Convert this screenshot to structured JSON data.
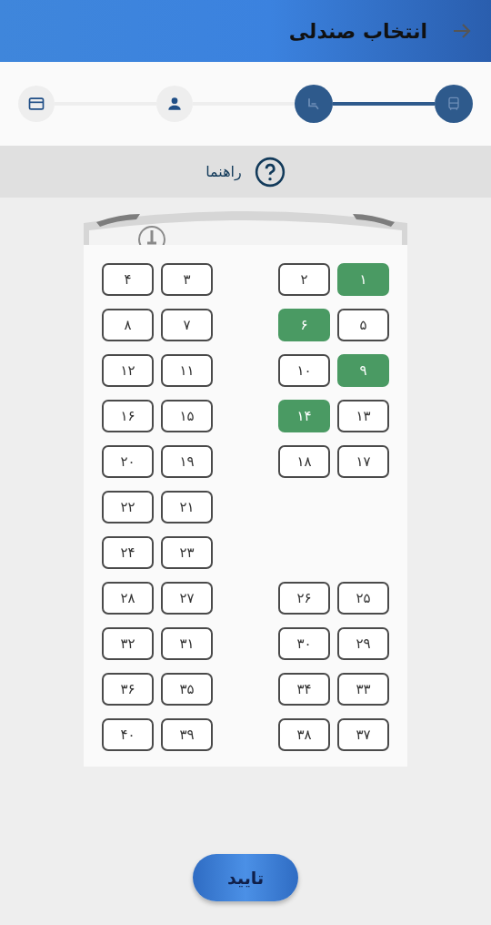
{
  "header": {
    "title": "انتخاب صندلی"
  },
  "steps": [
    {
      "kind": "bus",
      "done": true
    },
    {
      "kind": "seat",
      "done": true
    },
    {
      "kind": "person",
      "done": false
    },
    {
      "kind": "card",
      "done": false
    }
  ],
  "guide": {
    "label": "راهنما"
  },
  "seat_rows": [
    {
      "right": [
        {
          "number": "۱",
          "selected": true
        },
        {
          "number": "۲",
          "selected": false
        }
      ],
      "left": [
        {
          "number": "۳",
          "selected": false
        },
        {
          "number": "۴",
          "selected": false
        }
      ]
    },
    {
      "right": [
        {
          "number": "۵",
          "selected": false
        },
        {
          "number": "۶",
          "selected": true
        }
      ],
      "left": [
        {
          "number": "۷",
          "selected": false
        },
        {
          "number": "۸",
          "selected": false
        }
      ]
    },
    {
      "right": [
        {
          "number": "۹",
          "selected": true
        },
        {
          "number": "۱۰",
          "selected": false
        }
      ],
      "left": [
        {
          "number": "۱۱",
          "selected": false
        },
        {
          "number": "۱۲",
          "selected": false
        }
      ]
    },
    {
      "right": [
        {
          "number": "۱۳",
          "selected": false
        },
        {
          "number": "۱۴",
          "selected": true
        }
      ],
      "left": [
        {
          "number": "۱۵",
          "selected": false
        },
        {
          "number": "۱۶",
          "selected": false
        }
      ]
    },
    {
      "right": [
        {
          "number": "۱۷",
          "selected": false
        },
        {
          "number": "۱۸",
          "selected": false
        }
      ],
      "left": [
        {
          "number": "۱۹",
          "selected": false
        },
        {
          "number": "۲۰",
          "selected": false
        }
      ]
    },
    {
      "left": [
        {
          "number": "۲۱",
          "selected": false
        },
        {
          "number": "۲۲",
          "selected": false
        }
      ]
    },
    {
      "left": [
        {
          "number": "۲۳",
          "selected": false
        },
        {
          "number": "۲۴",
          "selected": false
        }
      ]
    },
    {
      "right": [
        {
          "number": "۲۵",
          "selected": false
        },
        {
          "number": "۲۶",
          "selected": false
        }
      ],
      "left": [
        {
          "number": "۲۷",
          "selected": false
        },
        {
          "number": "۲۸",
          "selected": false
        }
      ]
    },
    {
      "right": [
        {
          "number": "۲۹",
          "selected": false
        },
        {
          "number": "۳۰",
          "selected": false
        }
      ],
      "left": [
        {
          "number": "۳۱",
          "selected": false
        },
        {
          "number": "۳۲",
          "selected": false
        }
      ]
    },
    {
      "right": [
        {
          "number": "۳۳",
          "selected": false
        },
        {
          "number": "۳۴",
          "selected": false
        }
      ],
      "left": [
        {
          "number": "۳۵",
          "selected": false
        },
        {
          "number": "۳۶",
          "selected": false
        }
      ]
    },
    {
      "right": [
        {
          "number": "۳۷",
          "selected": false
        },
        {
          "number": "۳۸",
          "selected": false
        }
      ],
      "left": [
        {
          "number": "۳۹",
          "selected": false
        },
        {
          "number": "۴۰",
          "selected": false
        }
      ]
    }
  ],
  "confirm_button": {
    "label": "تایید"
  }
}
